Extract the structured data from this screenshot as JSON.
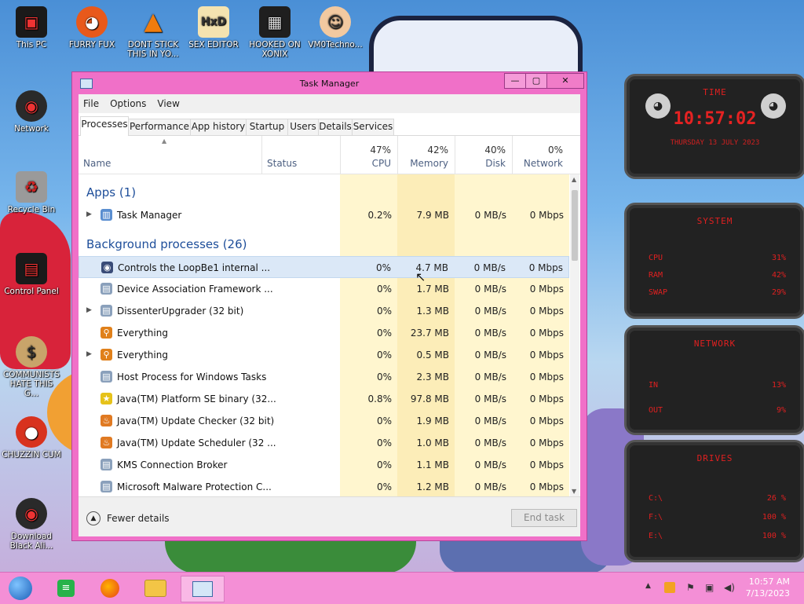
{
  "desktop_icons": [
    {
      "label": "This PC",
      "name": "this-pc"
    },
    {
      "label": "FURRY FUX",
      "name": "furry-fux"
    },
    {
      "label": "DONT STICK THIS IN YO...",
      "name": "dont-stick"
    },
    {
      "label": "SEX EDITOR",
      "name": "sex-editor"
    },
    {
      "label": "HOOKED ON XONIX",
      "name": "hooked-on-xonix"
    },
    {
      "label": "VM0Techno...",
      "name": "vm0techno"
    },
    {
      "label": "Network",
      "name": "network"
    },
    {
      "label": "Recycle Bin",
      "name": "recycle-bin"
    },
    {
      "label": "Control Panel",
      "name": "control-panel"
    },
    {
      "label": "COMMUNISTS HATE THIS G...",
      "name": "communists"
    },
    {
      "label": "CHUZZIN CUM",
      "name": "chuzzin"
    },
    {
      "label": "Download Black Ali...",
      "name": "download-black"
    }
  ],
  "window": {
    "title": "Task Manager",
    "btn_min": "—",
    "btn_max": "▢",
    "btn_close": "✕",
    "menu": [
      "File",
      "Options",
      "View"
    ],
    "tabs": [
      "Processes",
      "Performance",
      "App history",
      "Startup",
      "Users",
      "Details",
      "Services"
    ]
  },
  "columns": {
    "sort_arrow": "▲",
    "name": "Name",
    "status": "Status",
    "cpu_pct": "47%",
    "cpu": "CPU",
    "memory_pct": "42%",
    "memory": "Memory",
    "disk_pct": "40%",
    "disk": "Disk",
    "network_pct": "0%",
    "network": "Network"
  },
  "groups": {
    "apps": "Apps (1)",
    "background": "Background processes (26)"
  },
  "processes": [
    {
      "name": "Task Manager",
      "cpu": "0.2%",
      "memory": "7.9 MB",
      "disk": "0 MB/s",
      "network": "0 Mbps",
      "expand": true,
      "icon": "task-manager-icon",
      "glyph": "▥",
      "color": "#5a8ed0"
    },
    {
      "name": "Controls the LoopBe1 internal ...",
      "cpu": "0%",
      "memory": "4.7 MB",
      "disk": "0 MB/s",
      "network": "0 Mbps",
      "expand": false,
      "icon": "loopbe-icon",
      "glyph": "◉",
      "color": "#3a4c78"
    },
    {
      "name": "Device Association Framework ...",
      "cpu": "0%",
      "memory": "1.7 MB",
      "disk": "0 MB/s",
      "network": "0 Mbps",
      "expand": false,
      "icon": "service-window-icon",
      "glyph": "▤",
      "color": "#8aa0bb"
    },
    {
      "name": "DissenterUpgrader (32 bit)",
      "cpu": "0%",
      "memory": "1.3 MB",
      "disk": "0 MB/s",
      "network": "0 Mbps",
      "expand": true,
      "icon": "service-window-icon",
      "glyph": "▤",
      "color": "#8aa0bb"
    },
    {
      "name": "Everything",
      "cpu": "0%",
      "memory": "23.7 MB",
      "disk": "0 MB/s",
      "network": "0 Mbps",
      "expand": false,
      "icon": "everything-search-icon",
      "glyph": "⚲",
      "color": "#e0801a"
    },
    {
      "name": "Everything",
      "cpu": "0%",
      "memory": "0.5 MB",
      "disk": "0 MB/s",
      "network": "0 Mbps",
      "expand": true,
      "icon": "everything-search-icon",
      "glyph": "⚲",
      "color": "#e0801a"
    },
    {
      "name": "Host Process for Windows Tasks",
      "cpu": "0%",
      "memory": "2.3 MB",
      "disk": "0 MB/s",
      "network": "0 Mbps",
      "expand": false,
      "icon": "service-window-icon",
      "glyph": "▤",
      "color": "#8aa0bb"
    },
    {
      "name": "Java(TM) Platform SE binary (32...",
      "cpu": "0.8%",
      "memory": "97.8 MB",
      "disk": "0 MB/s",
      "network": "0 Mbps",
      "expand": false,
      "icon": "java-star-icon",
      "glyph": "★",
      "color": "#e6c21a"
    },
    {
      "name": "Java(TM) Update Checker (32 bit)",
      "cpu": "0%",
      "memory": "1.9 MB",
      "disk": "0 MB/s",
      "network": "0 Mbps",
      "expand": false,
      "icon": "java-icon",
      "glyph": "♨",
      "color": "#e07a22"
    },
    {
      "name": "Java(TM) Update Scheduler (32 ...",
      "cpu": "0%",
      "memory": "1.0 MB",
      "disk": "0 MB/s",
      "network": "0 Mbps",
      "expand": false,
      "icon": "java-icon",
      "glyph": "♨",
      "color": "#e07a22"
    },
    {
      "name": "KMS Connection Broker",
      "cpu": "0%",
      "memory": "1.1 MB",
      "disk": "0 MB/s",
      "network": "0 Mbps",
      "expand": false,
      "icon": "service-window-icon",
      "glyph": "▤",
      "color": "#8aa0bb"
    },
    {
      "name": "Microsoft Malware Protection C...",
      "cpu": "0%",
      "memory": "1.2 MB",
      "disk": "0 MB/s",
      "network": "0 Mbps",
      "expand": false,
      "icon": "service-window-icon",
      "glyph": "▤",
      "color": "#8aa0bb"
    }
  ],
  "footer": {
    "fewer_details": "Fewer details",
    "end_task": "End task"
  },
  "gadget": {
    "time_title": "TIME",
    "time": "10:57:02",
    "date": "THURSDAY 13 JULY 2023",
    "system_title": "SYSTEM",
    "cpu_label": "CPU",
    "cpu_value": "31%",
    "ram_label": "RAM",
    "ram_value": "42%",
    "swap_label": "SWAP",
    "swap_value": "29%",
    "network_title": "NETWORK",
    "in_label": "IN",
    "in_value": "13%",
    "out_label": "OUT",
    "out_value": "9%",
    "drives_title": "DRIVES",
    "drive_c": "C:\\",
    "drive_c_value": "26 %",
    "drive_f": "F:\\",
    "drive_f_value": "100 %",
    "drive_e": "E:\\",
    "drive_e_value": "100 %"
  },
  "taskbar": {
    "time": "10:57 AM",
    "date": "7/13/2023"
  },
  "colors": {
    "window_frame": "#f070c8",
    "taskbar": "#f48fd6",
    "group_header": "#1e4e9a",
    "cpu_heat": "#fff4c4",
    "memory_heat": "#fbe9ab",
    "widget_red": "#e52222"
  }
}
